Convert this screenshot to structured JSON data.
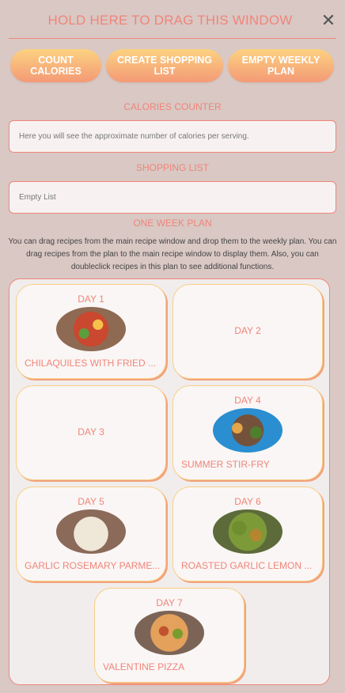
{
  "window": {
    "title": "HOLD HERE TO DRAG THIS WINDOW",
    "close_glyph": "✕"
  },
  "toolbar": {
    "count_label": "COUNT CALORIES",
    "shopping_label": "CREATE SHOPPING LIST",
    "empty_label": "EMPTY WEEKLY PLAN"
  },
  "calories": {
    "label": "CALORIES COUNTER",
    "text": "Here you will see the approximate number of calories per serving."
  },
  "shopping": {
    "label": "SHOPPING LIST",
    "text": "Empty List"
  },
  "plan": {
    "label": "ONE WEEK PLAN",
    "description": "You can drag recipes from the main recipe window and drop them to the weekly plan. You can drag recipes from the plan to the main recipe window to display them. Also, you can doubleclick recipes in this plan to see additional functions.",
    "days": [
      {
        "label": "DAY 1",
        "recipe": "CHILAQUILES WITH FRIED ..."
      },
      {
        "label": "DAY 2",
        "recipe": ""
      },
      {
        "label": "DAY 3",
        "recipe": ""
      },
      {
        "label": "DAY 4",
        "recipe": "SUMMER STIR-FRY"
      },
      {
        "label": "DAY 5",
        "recipe": "GARLIC ROSEMARY PARME..."
      },
      {
        "label": "DAY 6",
        "recipe": "ROASTED GARLIC LEMON ..."
      },
      {
        "label": "DAY 7",
        "recipe": "VALENTINE PIZZA"
      }
    ]
  },
  "colors": {
    "accent": "#f0857a",
    "background": "#d9c8c4",
    "card_border": "#f8cf85"
  }
}
